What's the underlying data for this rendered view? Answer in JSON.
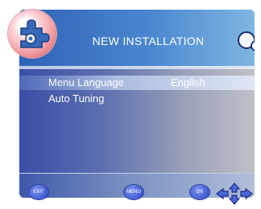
{
  "header": {
    "title": "NEW INSTALLATION"
  },
  "menu": {
    "items": [
      {
        "label": "Menu Language",
        "value": "English",
        "selected": true
      },
      {
        "label": "Auto Tuning",
        "value": "",
        "selected": false
      }
    ]
  },
  "footer": {
    "exit_label": "EXIT",
    "menu_label": "MENU",
    "ok_label": "OK"
  },
  "icons": {
    "logo": "puzzle-gear-icon",
    "corner": "bubbles-icon",
    "nav": "direction-arrows-icon"
  },
  "colors": {
    "header": "#2f62b5",
    "selected_row": "#aabbe0",
    "button": "#3e5ad2"
  }
}
